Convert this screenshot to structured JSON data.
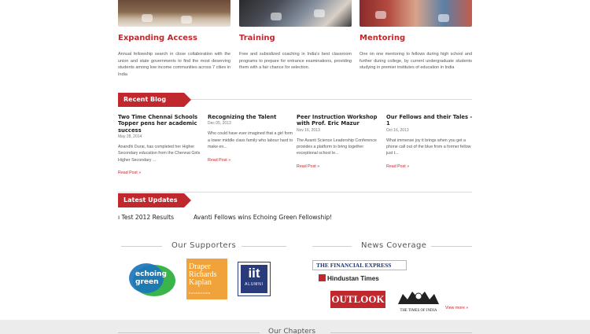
{
  "features": [
    {
      "title": "Expanding Access",
      "text": "Annual fellowship search in close collaboration with the union and state governments to find the most deserving students among low income communities across 7 cities in India"
    },
    {
      "title": "Training",
      "text": "Free and subsidized coaching in India's best classroom programs to prepare for entrance examinations, providing them with a fair chance for selection."
    },
    {
      "title": "Mentoring",
      "text": "One on one mentoring to fellows during high school and further during college, by current undergraduate students studying in premier institutes of education in India"
    }
  ],
  "blog": {
    "heading": "Recent Blog Posts",
    "read_more": "Read Post »",
    "posts": [
      {
        "title": "Two Time Chennai Schools Topper pens her academic success",
        "date": "May 28, 2014",
        "excerpt": "Anandhi Durai, has completed her Higher Secondary education from the Chennai Girls Higher Secondary ..."
      },
      {
        "title": "Recognizing the Talent",
        "date": "Dec 05, 2013",
        "excerpt": "Who could have ever imagined that a girl form a lower middle class family who labour hard to make en..."
      },
      {
        "title": "Peer Instruction Workshop with Prof. Eric Mazur",
        "date": "Nov 16, 2013",
        "excerpt": "The Avanti Science Leadership Conference provides a platform to bring together exceptional school le..."
      },
      {
        "title": "Our Fellows and their Tales - 1",
        "date": "Oct 16, 2013",
        "excerpt": "What immense joy it brings when you get a phone call out of the blue from a former fellow just t..."
      }
    ]
  },
  "updates": {
    "heading": "Latest Updates",
    "items": [
      "ı Test 2012 Results",
      "Avanti Fellows wins Echoing Green Fellowship!"
    ]
  },
  "supporters": {
    "heading": "Our Supporters",
    "echoing_green": "echoing green",
    "drk_line1": "Draper",
    "drk_line2": "Richards",
    "drk_line3": "Kaplan",
    "drk_sub": "FOUNDATION",
    "iit_big": "iit",
    "iit_sub": "ALUMNI"
  },
  "news": {
    "heading": "News Coverage",
    "financial_express": "THE FINANCIAL EXPRESS",
    "hindustan_times": "Hindustan Times",
    "outlook": "OUTLOOK",
    "times_of_india": "THE TIMES OF INDIA",
    "view_more": "View more »"
  },
  "footer": {
    "title": "Our Chapters"
  },
  "colors": {
    "accent": "#c0282d",
    "echoing_blue": "#1b75bc",
    "echoing_green": "#3ab54a",
    "drk_orange": "#f0a33b",
    "iit_navy": "#2a3b7c"
  }
}
